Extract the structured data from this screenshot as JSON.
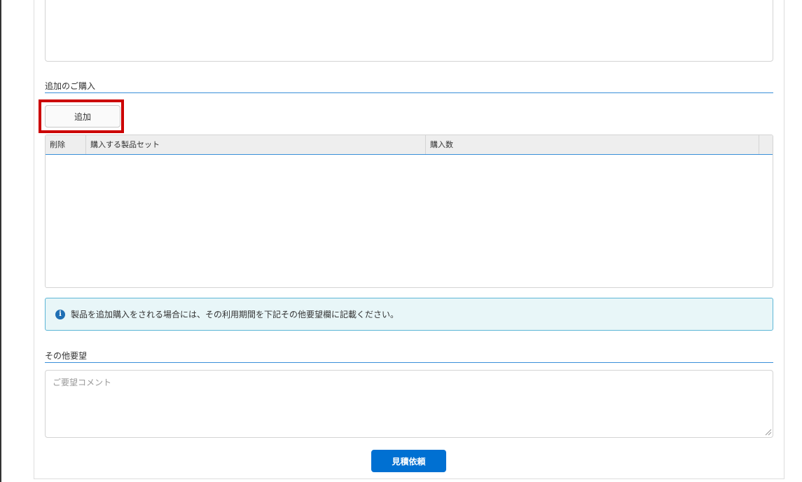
{
  "additional_purchase": {
    "section_title": "追加のご購入",
    "add_button_label": "追加",
    "grid": {
      "columns": [
        "削除",
        "購入する製品セット",
        "購入数"
      ],
      "rows": []
    },
    "info_message": "製品を追加購入をされる場合には、その利用期間を下記その他要望欄に記載ください。"
  },
  "other_requests": {
    "section_title": "その他要望",
    "comment_placeholder": "ご要望コメント",
    "comment_value": ""
  },
  "submit_button_label": "見積依頼",
  "colors": {
    "accent": "#0070d2",
    "highlight": "#cc0000",
    "info_bg": "#e8f6f8",
    "info_border": "#5cb6d6",
    "section_rule": "#3a8fd9"
  },
  "icons": {
    "info": "info-circle-icon",
    "resize": "resize-grip-icon"
  }
}
